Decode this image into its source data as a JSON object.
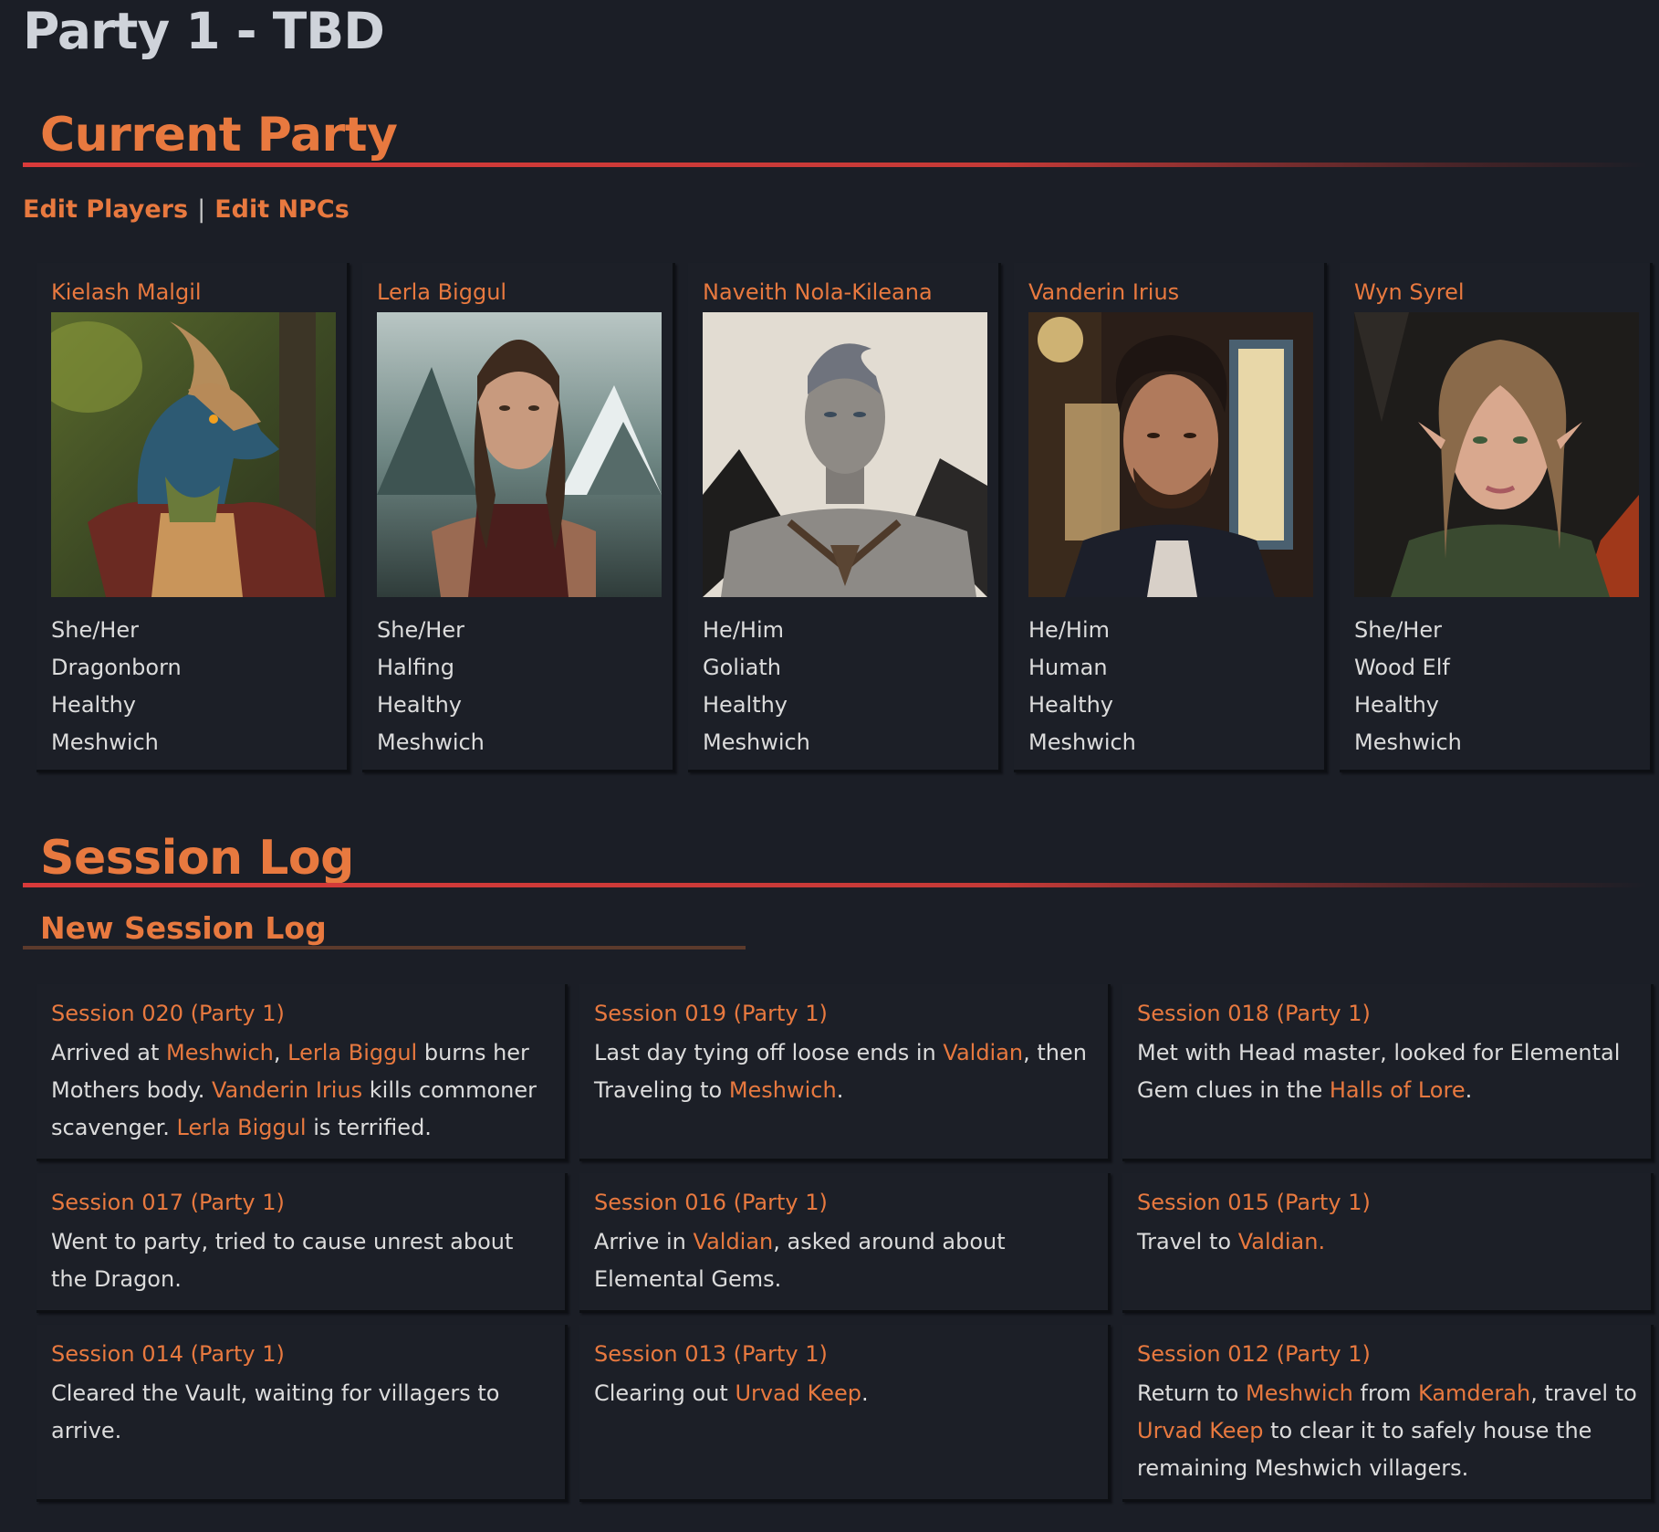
{
  "page": {
    "title": "Party 1 - TBD"
  },
  "current_party": {
    "heading": "Current Party",
    "edit_players": "Edit Players",
    "separator": "|",
    "edit_npcs": "Edit NPCs",
    "characters": [
      {
        "name": "Kielash Malgil",
        "pronouns": "She/Her",
        "race": "Dragonborn",
        "status": "Healthy",
        "location": "Meshwich"
      },
      {
        "name": "Lerla Biggul",
        "pronouns": "She/Her",
        "race": "Halfing",
        "status": "Healthy",
        "location": "Meshwich"
      },
      {
        "name": "Naveith Nola-Kileana",
        "pronouns": "He/Him",
        "race": "Goliath",
        "status": "Healthy",
        "location": "Meshwich"
      },
      {
        "name": "Vanderin Irius",
        "pronouns": "He/Him",
        "race": "Human",
        "status": "Healthy",
        "location": "Meshwich"
      },
      {
        "name": "Wyn Syrel",
        "pronouns": "She/Her",
        "race": "Wood Elf",
        "status": "Healthy",
        "location": "Meshwich"
      }
    ]
  },
  "session_log": {
    "heading": "Session Log",
    "new_session": "New Session Log",
    "sessions": [
      {
        "title": "Session 020 (Party 1)",
        "parts": [
          {
            "t": "Arrived at "
          },
          {
            "t": "Meshwich",
            "link": true
          },
          {
            "t": ", "
          },
          {
            "t": "Lerla Biggul",
            "link": true
          },
          {
            "t": " burns her Mothers body. "
          },
          {
            "t": "Vanderin Irius",
            "link": true
          },
          {
            "t": " kills commoner scavenger. "
          },
          {
            "t": "Lerla Biggul",
            "link": true
          },
          {
            "t": " is terrified."
          }
        ]
      },
      {
        "title": "Session 019 (Party 1)",
        "parts": [
          {
            "t": "Last day tying off loose ends in "
          },
          {
            "t": "Valdian",
            "link": true
          },
          {
            "t": ", then Traveling to "
          },
          {
            "t": "Meshwich",
            "link": true
          },
          {
            "t": "."
          }
        ]
      },
      {
        "title": "Session 018 (Party 1)",
        "parts": [
          {
            "t": "Met with Head master, looked for Elemental Gem clues in the "
          },
          {
            "t": "Halls of Lore",
            "link": true
          },
          {
            "t": "."
          }
        ]
      },
      {
        "title": "Session 017 (Party 1)",
        "parts": [
          {
            "t": "Went to party, tried to cause unrest about the Dragon."
          }
        ]
      },
      {
        "title": "Session 016 (Party 1)",
        "parts": [
          {
            "t": "Arrive in "
          },
          {
            "t": "Valdian",
            "link": true
          },
          {
            "t": ", asked around about Elemental Gems."
          }
        ]
      },
      {
        "title": "Session 015 (Party 1)",
        "parts": [
          {
            "t": "Travel to "
          },
          {
            "t": "Valdian.",
            "link": true
          }
        ]
      },
      {
        "title": "Session 014 (Party 1)",
        "parts": [
          {
            "t": "Cleared the Vault, waiting for villagers to arrive."
          }
        ]
      },
      {
        "title": "Session 013 (Party 1)",
        "parts": [
          {
            "t": "Clearing out "
          },
          {
            "t": "Urvad Keep",
            "link": true
          },
          {
            "t": "."
          }
        ]
      },
      {
        "title": "Session 012 (Party 1)",
        "parts": [
          {
            "t": "Return to "
          },
          {
            "t": "Meshwich",
            "link": true
          },
          {
            "t": " from "
          },
          {
            "t": "Kamderah",
            "link": true
          },
          {
            "t": ", travel to "
          },
          {
            "t": "Urvad Keep",
            "link": true
          },
          {
            "t": " to clear it to safely house the remaining Meshwich villagers."
          }
        ]
      }
    ]
  },
  "colors": {
    "background": "#1b1e26",
    "accent": "#e8793f",
    "rule": "#d93a3a",
    "text": "#dcdcdc",
    "title": "#cfd3da"
  }
}
